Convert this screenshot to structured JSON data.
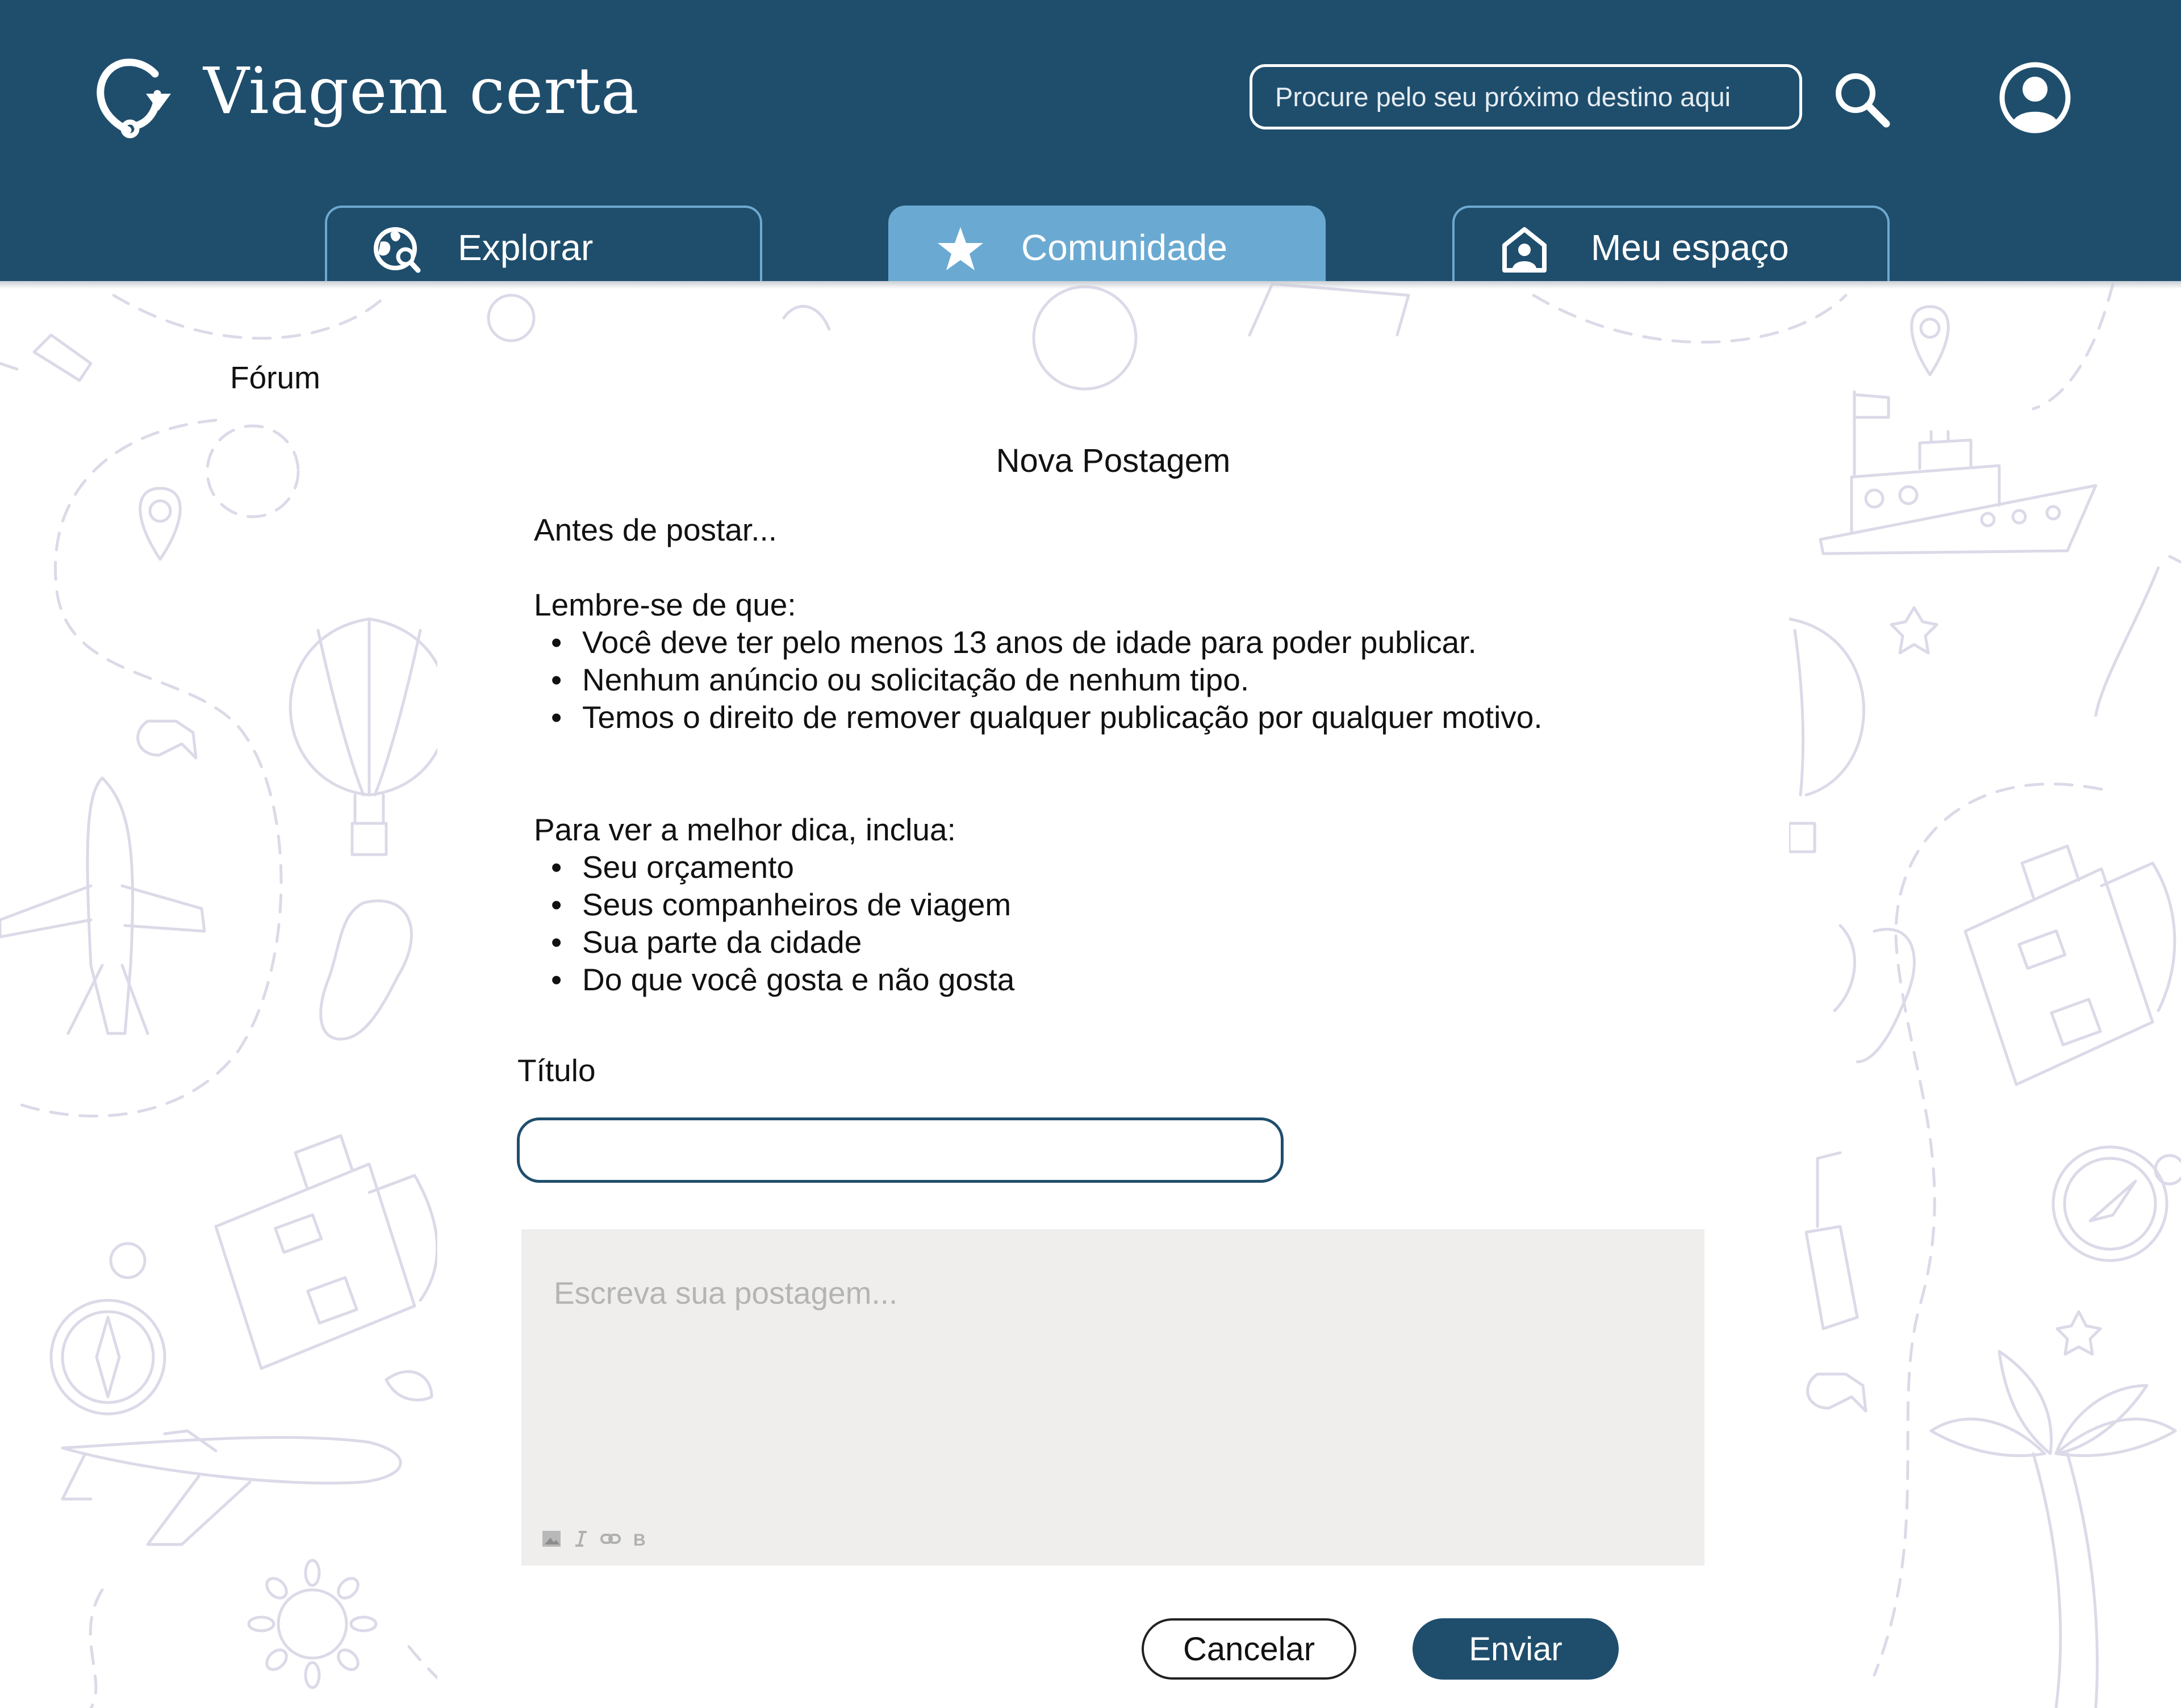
{
  "app": {
    "name": "Viagem certa",
    "search_placeholder": "Procure pelo seu próximo destino aqui"
  },
  "nav": {
    "tabs": [
      {
        "label": "Explorar",
        "icon": "globe-search-icon",
        "active": false
      },
      {
        "label": "Comunidade",
        "icon": "star-icon",
        "active": true
      },
      {
        "label": "Meu espaço",
        "icon": "home-user-icon",
        "active": false
      }
    ]
  },
  "breadcrumb": "Fórum",
  "form": {
    "title": "Nova Postagem",
    "intro": "Antes de postar...",
    "rules_heading": "Lembre-se de que:",
    "rules": [
      "Você deve ter pelo menos 13 anos de idade para poder publicar.",
      "Nenhum anúncio ou solicitação de nenhum tipo.",
      "Temos o direito de remover qualquer publicação por qualquer motivo."
    ],
    "tips_heading": "Para ver a melhor dica, inclua:",
    "tips": [
      "Seu orçamento",
      "Seus companheiros de viagem",
      "Sua parte da cidade",
      "Do que você gosta e não gosta"
    ],
    "title_label": "Título",
    "title_value": "",
    "post_placeholder": "Escreva sua postagem...",
    "toolbar": {
      "image_icon": "image-icon",
      "italic_label": "I",
      "link_icon": "link-icon",
      "bold_label": "B"
    },
    "cancel_label": "Cancelar",
    "send_label": "Enviar"
  },
  "colors": {
    "header_bg": "#1f4e6d",
    "tab_active_bg": "#6aaad2",
    "primary_button": "#1f4e6d",
    "editor_bg": "#efeeec",
    "doodle_stroke": "#dcd9e8"
  }
}
